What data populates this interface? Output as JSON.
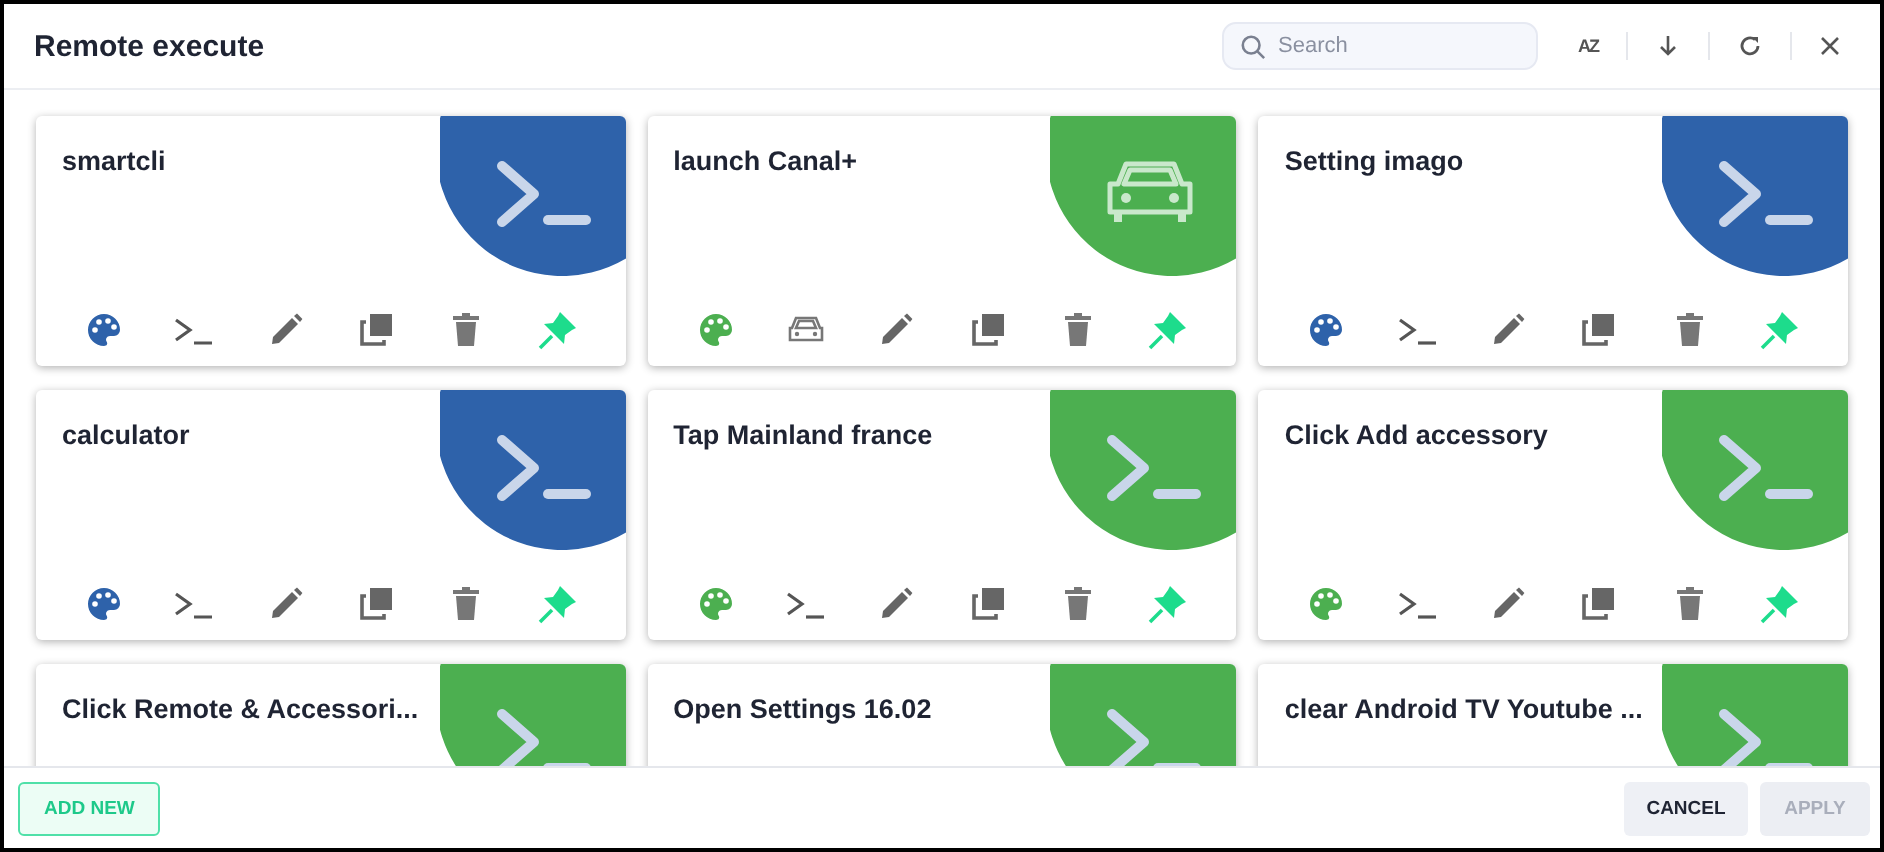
{
  "window": {
    "title": "Remote execute"
  },
  "search": {
    "placeholder": "Search"
  },
  "sort_label": "AZ",
  "cards": [
    {
      "title": "smartcli",
      "color": "#2e62aa",
      "kind": "terminal"
    },
    {
      "title": "launch Canal+",
      "color": "#4caf50",
      "kind": "car"
    },
    {
      "title": "Setting imago",
      "color": "#2e62aa",
      "kind": "terminal"
    },
    {
      "title": "calculator",
      "color": "#2e62aa",
      "kind": "terminal"
    },
    {
      "title": "Tap Mainland france",
      "color": "#4caf50",
      "kind": "terminal"
    },
    {
      "title": "Click Add accessory",
      "color": "#4caf50",
      "kind": "terminal"
    },
    {
      "title": "Click Remote & Accessori...",
      "color": "#4caf50",
      "kind": "terminal"
    },
    {
      "title": "Open Settings 16.02",
      "color": "#4caf50",
      "kind": "terminal"
    },
    {
      "title": "clear Android TV Youtube ...",
      "color": "#4caf50",
      "kind": "terminal"
    }
  ],
  "footer": {
    "add": "ADD NEW",
    "cancel": "CANCEL",
    "apply": "APPLY",
    "apply_disabled": true
  }
}
